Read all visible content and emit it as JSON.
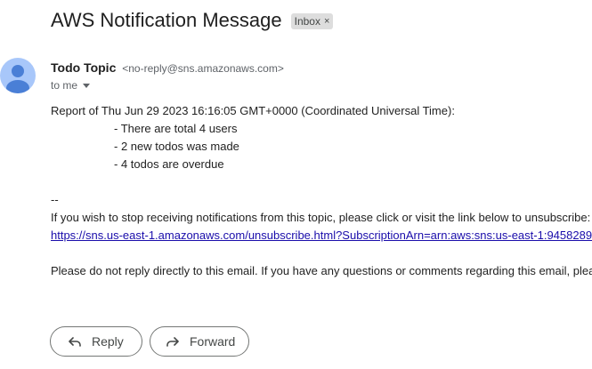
{
  "email": {
    "subject": "AWS Notification Message",
    "label": "Inbox",
    "label_close": "×",
    "sender_name": "Todo Topic",
    "sender_email": "<no-reply@sns.amazonaws.com>",
    "recipient": "to me",
    "body": {
      "intro": "Report of Thu Jun 29 2023 16:16:05 GMT+0000 (Coordinated Universal Time):",
      "items": [
        "- There are total 4 users",
        "- 2 new todos was made",
        "- 4 todos are overdue"
      ],
      "separator": "--",
      "unsubscribe_text": "If you wish to stop receiving notifications from this topic, please click or visit the link below to unsubscribe:",
      "unsubscribe_link": "https://sns.us-east-1.amazonaws.com/unsubscribe.html?SubscriptionArn=arn:aws:sns:us-east-1:9458289",
      "footer": "Please do not reply directly to this email. If you have any questions or comments regarding this email, plea"
    }
  },
  "actions": {
    "reply_label": "Reply",
    "forward_label": "Forward"
  },
  "icons": {
    "avatar": "person-icon",
    "reply": "reply-arrow-icon",
    "forward": "forward-arrow-icon",
    "recipient_details": "caret-down-icon"
  },
  "colors": {
    "link": "#1a0dab",
    "avatar_bg": "#a8c7fa",
    "avatar_fg": "#4a7fd6",
    "chip_bg": "#dddddd"
  }
}
